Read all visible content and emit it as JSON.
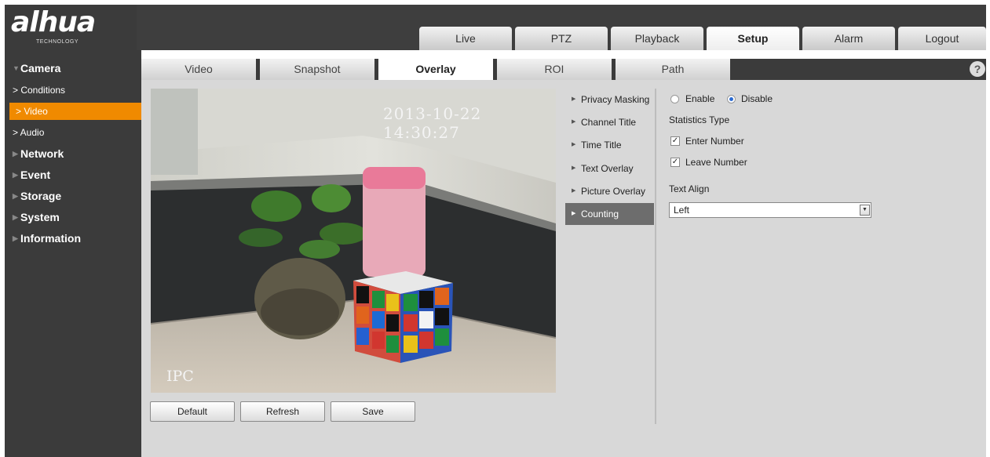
{
  "brand": {
    "name": "alhua",
    "subtitle": "TECHNOLOGY"
  },
  "top_tabs": [
    {
      "label": "Live"
    },
    {
      "label": "PTZ"
    },
    {
      "label": "Playback"
    },
    {
      "label": "Setup",
      "active": true
    },
    {
      "label": "Alarm"
    },
    {
      "label": "Logout"
    }
  ],
  "sidebar": {
    "camera": "Camera",
    "camera_sub": [
      "> Conditions",
      "> Video",
      "> Audio"
    ],
    "sections": [
      "Network",
      "Event",
      "Storage",
      "System",
      "Information"
    ]
  },
  "sub_tabs": [
    {
      "label": "Video"
    },
    {
      "label": "Snapshot"
    },
    {
      "label": "Overlay",
      "active": true
    },
    {
      "label": "ROI"
    },
    {
      "label": "Path"
    }
  ],
  "help_icon": "?",
  "video": {
    "timestamp": "2013-10-22 14:30:27",
    "channel_name": "IPC"
  },
  "buttons": {
    "default": "Default",
    "refresh": "Refresh",
    "save": "Save"
  },
  "overlay_menu": [
    "Privacy Masking",
    "Channel Title",
    "Time Title",
    "Text Overlay",
    "Picture Overlay",
    "Counting"
  ],
  "counting": {
    "enable_label": "Enable",
    "disable_label": "Disable",
    "selected": "Disable",
    "statistics_type_label": "Statistics Type",
    "enter_number_label": "Enter Number",
    "enter_number_checked": true,
    "leave_number_label": "Leave Number",
    "leave_number_checked": true,
    "text_align_label": "Text Align",
    "text_align_value": "Left"
  },
  "colors": {
    "header_bg": "#3e3e3e",
    "sidebar_active": "#f08a00",
    "menu_active": "#6d6d6d",
    "content_bg": "#d8d8d8"
  },
  "icons": {
    "help": "question-circle-icon",
    "dropdown": "chevron-down-icon",
    "menu_marker": "triangle-right-icon"
  }
}
